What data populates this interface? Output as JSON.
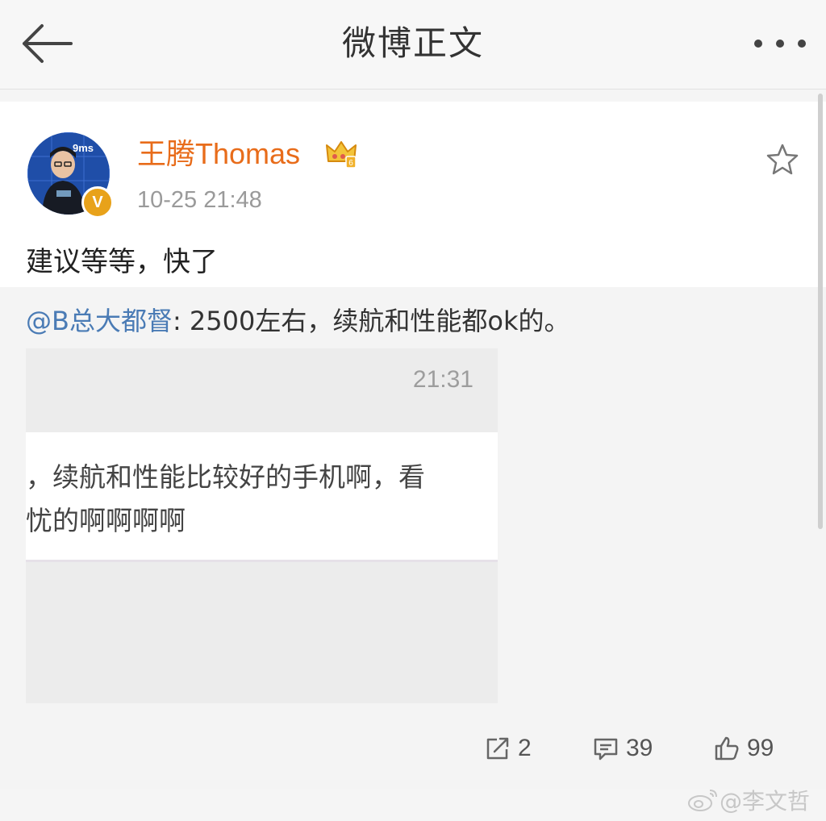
{
  "header": {
    "title": "微博正文"
  },
  "post": {
    "author": "王腾Thomas",
    "timestamp": "10-25 21:48",
    "text": "建议等等，快了",
    "avatar_badge": "V",
    "avatar_text": "9ms"
  },
  "retweet": {
    "user": "@B总大都督",
    "separator": ": ",
    "text": "2500左右，续航和性能都ok的。",
    "image": {
      "time": "21:31",
      "line1": "，续航和性能比较好的手机啊，看",
      "line2": "忧的啊啊啊啊"
    }
  },
  "actions": {
    "repost_count": "2",
    "comment_count": "39",
    "like_count": "99"
  },
  "watermark": "@李文哲",
  "colors": {
    "username": "#e86c1a",
    "mention": "#4a7bb5",
    "verified": "#e8a21a"
  }
}
